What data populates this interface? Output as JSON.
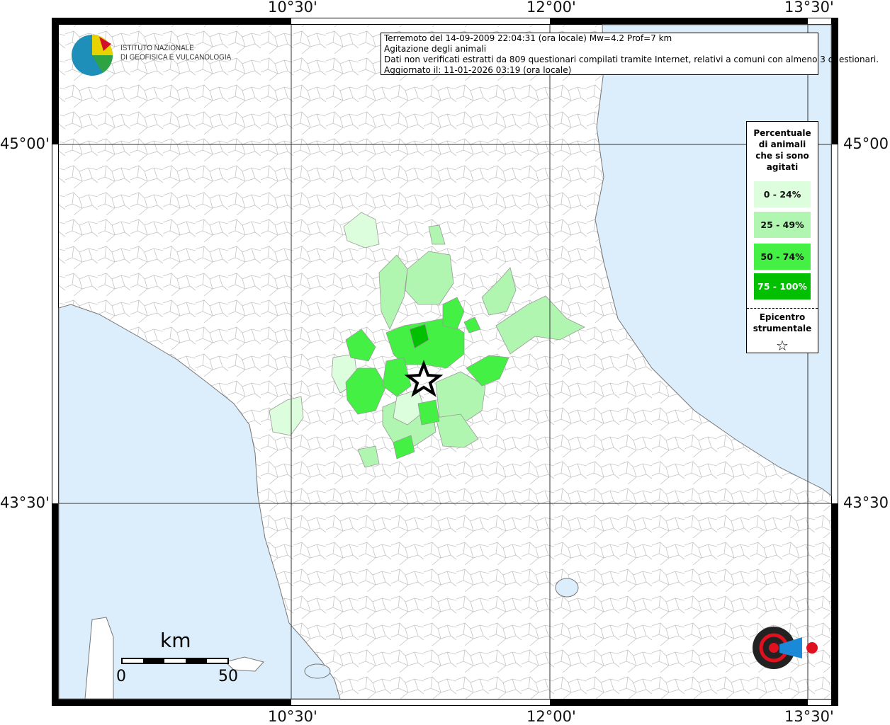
{
  "header": {
    "lines": [
      "Terremoto del 14-09-2009 22:04:31 (ora locale) Mw=4.2 Prof=7 km",
      "Agitazione degli animali",
      "Dati non verificati estratti da 809 questionari compilati tramite Internet, relativi a comuni con almeno 3 questionari.",
      "Aggiornato il: 11-01-2026 03:19 (ora locale)"
    ]
  },
  "axes": {
    "longitude_labels": [
      "10°30'",
      "12°00'",
      "13°30'"
    ],
    "latitude_labels": [
      "45°00'",
      "43°30'"
    ]
  },
  "legend": {
    "title_lines": [
      "Percentuale",
      "di animali",
      "che si sono",
      "agitati"
    ],
    "classes": [
      {
        "label": "0 - 24%",
        "color": "#ddfedd",
        "text_color": "#111111"
      },
      {
        "label": "25 - 49%",
        "color": "#b0f5b0",
        "text_color": "#111111"
      },
      {
        "label": "50 - 74%",
        "color": "#44f044",
        "text_color": "#111111"
      },
      {
        "label": "75 - 100%",
        "color": "#00c000",
        "text_color": "#ffffff"
      }
    ],
    "epicenter_lines": [
      "Epicentro",
      "strumentale"
    ],
    "epicenter_symbol": "☆"
  },
  "scale": {
    "unit": "km",
    "min_label": "0",
    "max_label": "50"
  },
  "logos": {
    "ingv": [
      "ISTITUTO NAZIONALE",
      "DI GEOFISICA E VULCANOLOGIA"
    ],
    "hsit": "www.haisentitoilterremoto.it"
  },
  "colors": {
    "sea": "#dcedfb",
    "land": "#ffffff",
    "border": "#bdbdbd",
    "grid": "#333333"
  }
}
